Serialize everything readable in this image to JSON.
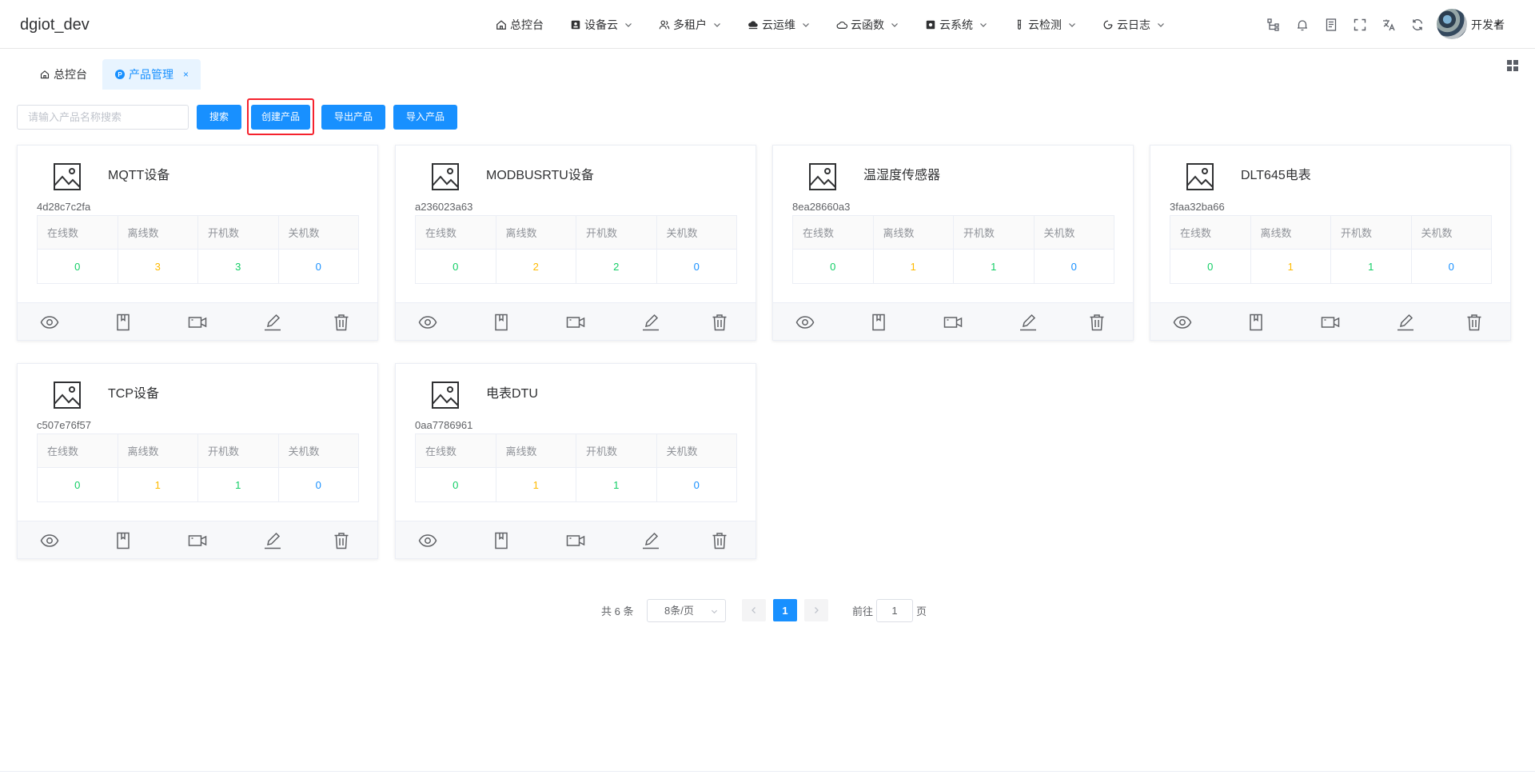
{
  "header": {
    "app_title": "dgiot_dev",
    "nav": [
      {
        "label": "总控台",
        "icon": "home-icon"
      },
      {
        "label": "设备云",
        "icon": "device-icon"
      },
      {
        "label": "多租户",
        "icon": "users-icon"
      },
      {
        "label": "云运维",
        "icon": "cloud-ops-icon"
      },
      {
        "label": "云函数",
        "icon": "cloud-icon"
      },
      {
        "label": "云系统",
        "icon": "system-icon"
      },
      {
        "label": "云检测",
        "icon": "test-tube-icon"
      },
      {
        "label": "云日志",
        "icon": "log-icon"
      }
    ],
    "user_name": "开发者"
  },
  "tabs": {
    "home": "总控台",
    "active": "产品管理",
    "close": "×"
  },
  "toolbar": {
    "search_placeholder": "请输入产品名称搜索",
    "search_label": "搜索",
    "create_label": "创建产品",
    "export_label": "导出产品",
    "import_label": "导入产品"
  },
  "stat_headers": [
    "在线数",
    "离线数",
    "开机数",
    "关机数"
  ],
  "products": [
    {
      "name": "MQTT设备",
      "id": "4d28c7c2fa",
      "online": "0",
      "offline": "3",
      "on": "3",
      "off": "0"
    },
    {
      "name": "MODBUSRTU设备",
      "id": "a236023a63",
      "online": "0",
      "offline": "2",
      "on": "2",
      "off": "0"
    },
    {
      "name": "温湿度传感器",
      "id": "8ea28660a3",
      "online": "0",
      "offline": "1",
      "on": "1",
      "off": "0"
    },
    {
      "name": "DLT645电表",
      "id": "3faa32ba66",
      "online": "0",
      "offline": "1",
      "on": "1",
      "off": "0"
    },
    {
      "name": "TCP设备",
      "id": "c507e76f57",
      "online": "0",
      "offline": "1",
      "on": "1",
      "off": "0"
    },
    {
      "name": "电表DTU",
      "id": "0aa7786961",
      "online": "0",
      "offline": "1",
      "on": "1",
      "off": "0"
    }
  ],
  "pagination": {
    "total": "共 6 条",
    "page_size": "8条/页",
    "current": "1",
    "goto_pre": "前往",
    "goto_value": "1",
    "goto_post": "页"
  },
  "colors": {
    "primary": "#1890ff",
    "online": "#13ce66",
    "offline": "#ffba00",
    "off": "#1890ff",
    "highlight": "#f5222d"
  }
}
